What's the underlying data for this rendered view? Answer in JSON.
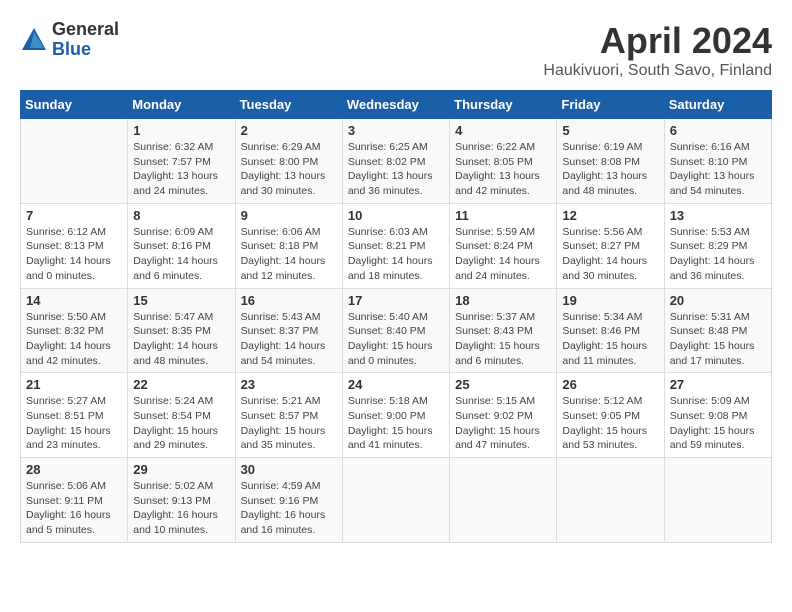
{
  "logo": {
    "general": "General",
    "blue": "Blue"
  },
  "title": "April 2024",
  "subtitle": "Haukivuori, South Savo, Finland",
  "days_of_week": [
    "Sunday",
    "Monday",
    "Tuesday",
    "Wednesday",
    "Thursday",
    "Friday",
    "Saturday"
  ],
  "weeks": [
    [
      {
        "day": "",
        "info": ""
      },
      {
        "day": "1",
        "info": "Sunrise: 6:32 AM\nSunset: 7:57 PM\nDaylight: 13 hours\nand 24 minutes."
      },
      {
        "day": "2",
        "info": "Sunrise: 6:29 AM\nSunset: 8:00 PM\nDaylight: 13 hours\nand 30 minutes."
      },
      {
        "day": "3",
        "info": "Sunrise: 6:25 AM\nSunset: 8:02 PM\nDaylight: 13 hours\nand 36 minutes."
      },
      {
        "day": "4",
        "info": "Sunrise: 6:22 AM\nSunset: 8:05 PM\nDaylight: 13 hours\nand 42 minutes."
      },
      {
        "day": "5",
        "info": "Sunrise: 6:19 AM\nSunset: 8:08 PM\nDaylight: 13 hours\nand 48 minutes."
      },
      {
        "day": "6",
        "info": "Sunrise: 6:16 AM\nSunset: 8:10 PM\nDaylight: 13 hours\nand 54 minutes."
      }
    ],
    [
      {
        "day": "7",
        "info": "Sunrise: 6:12 AM\nSunset: 8:13 PM\nDaylight: 14 hours\nand 0 minutes."
      },
      {
        "day": "8",
        "info": "Sunrise: 6:09 AM\nSunset: 8:16 PM\nDaylight: 14 hours\nand 6 minutes."
      },
      {
        "day": "9",
        "info": "Sunrise: 6:06 AM\nSunset: 8:18 PM\nDaylight: 14 hours\nand 12 minutes."
      },
      {
        "day": "10",
        "info": "Sunrise: 6:03 AM\nSunset: 8:21 PM\nDaylight: 14 hours\nand 18 minutes."
      },
      {
        "day": "11",
        "info": "Sunrise: 5:59 AM\nSunset: 8:24 PM\nDaylight: 14 hours\nand 24 minutes."
      },
      {
        "day": "12",
        "info": "Sunrise: 5:56 AM\nSunset: 8:27 PM\nDaylight: 14 hours\nand 30 minutes."
      },
      {
        "day": "13",
        "info": "Sunrise: 5:53 AM\nSunset: 8:29 PM\nDaylight: 14 hours\nand 36 minutes."
      }
    ],
    [
      {
        "day": "14",
        "info": "Sunrise: 5:50 AM\nSunset: 8:32 PM\nDaylight: 14 hours\nand 42 minutes."
      },
      {
        "day": "15",
        "info": "Sunrise: 5:47 AM\nSunset: 8:35 PM\nDaylight: 14 hours\nand 48 minutes."
      },
      {
        "day": "16",
        "info": "Sunrise: 5:43 AM\nSunset: 8:37 PM\nDaylight: 14 hours\nand 54 minutes."
      },
      {
        "day": "17",
        "info": "Sunrise: 5:40 AM\nSunset: 8:40 PM\nDaylight: 15 hours\nand 0 minutes."
      },
      {
        "day": "18",
        "info": "Sunrise: 5:37 AM\nSunset: 8:43 PM\nDaylight: 15 hours\nand 6 minutes."
      },
      {
        "day": "19",
        "info": "Sunrise: 5:34 AM\nSunset: 8:46 PM\nDaylight: 15 hours\nand 11 minutes."
      },
      {
        "day": "20",
        "info": "Sunrise: 5:31 AM\nSunset: 8:48 PM\nDaylight: 15 hours\nand 17 minutes."
      }
    ],
    [
      {
        "day": "21",
        "info": "Sunrise: 5:27 AM\nSunset: 8:51 PM\nDaylight: 15 hours\nand 23 minutes."
      },
      {
        "day": "22",
        "info": "Sunrise: 5:24 AM\nSunset: 8:54 PM\nDaylight: 15 hours\nand 29 minutes."
      },
      {
        "day": "23",
        "info": "Sunrise: 5:21 AM\nSunset: 8:57 PM\nDaylight: 15 hours\nand 35 minutes."
      },
      {
        "day": "24",
        "info": "Sunrise: 5:18 AM\nSunset: 9:00 PM\nDaylight: 15 hours\nand 41 minutes."
      },
      {
        "day": "25",
        "info": "Sunrise: 5:15 AM\nSunset: 9:02 PM\nDaylight: 15 hours\nand 47 minutes."
      },
      {
        "day": "26",
        "info": "Sunrise: 5:12 AM\nSunset: 9:05 PM\nDaylight: 15 hours\nand 53 minutes."
      },
      {
        "day": "27",
        "info": "Sunrise: 5:09 AM\nSunset: 9:08 PM\nDaylight: 15 hours\nand 59 minutes."
      }
    ],
    [
      {
        "day": "28",
        "info": "Sunrise: 5:06 AM\nSunset: 9:11 PM\nDaylight: 16 hours\nand 5 minutes."
      },
      {
        "day": "29",
        "info": "Sunrise: 5:02 AM\nSunset: 9:13 PM\nDaylight: 16 hours\nand 10 minutes."
      },
      {
        "day": "30",
        "info": "Sunrise: 4:59 AM\nSunset: 9:16 PM\nDaylight: 16 hours\nand 16 minutes."
      },
      {
        "day": "",
        "info": ""
      },
      {
        "day": "",
        "info": ""
      },
      {
        "day": "",
        "info": ""
      },
      {
        "day": "",
        "info": ""
      }
    ]
  ]
}
